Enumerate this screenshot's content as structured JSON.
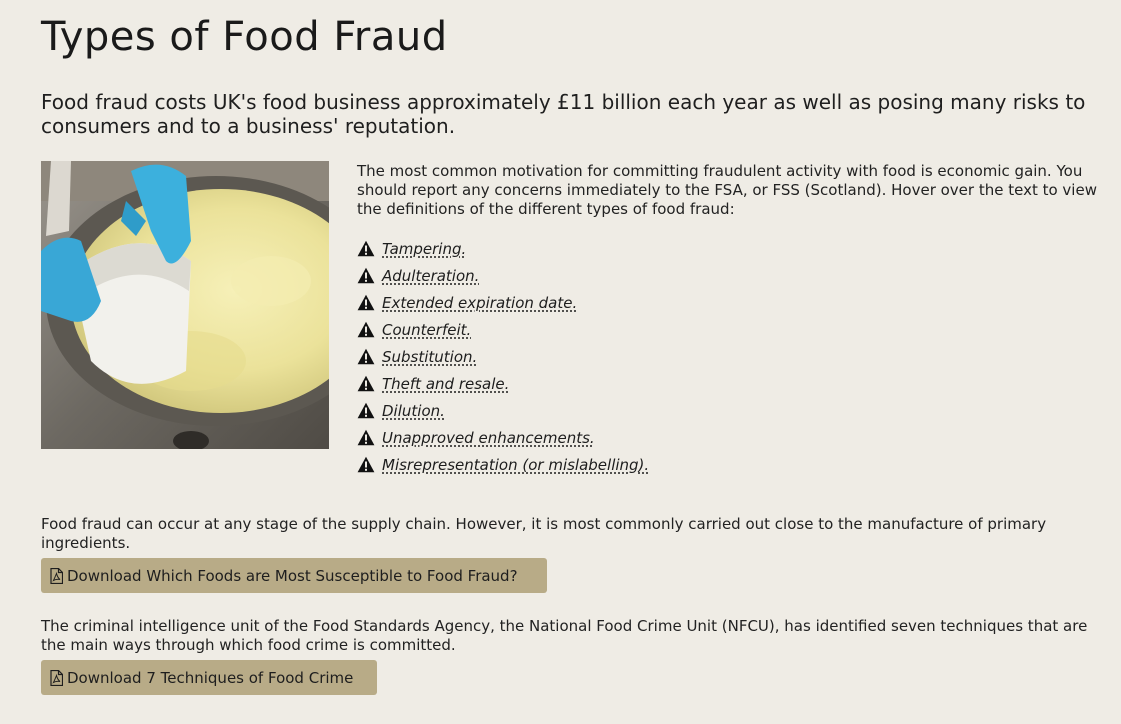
{
  "title": "Types of Food Fraud",
  "lead": "Food fraud costs UK's food business approximately £11 billion each year as well as posing many risks to consumers and to a business' reputation.",
  "hero_image": {
    "icon": "cheese-curd-vat-photo"
  },
  "intro": "The most common motivation for committing fraudulent activity with food is economic gain. You should report any concerns immediately to the FSA, or FSS (Scotland). Hover over the text to view the definitions of the different types of food fraud:",
  "fraud_types": [
    {
      "label": "Tampering."
    },
    {
      "label": "Adulteration."
    },
    {
      "label": "Extended expiration date."
    },
    {
      "label": "Counterfeit."
    },
    {
      "label": "Substitution."
    },
    {
      "label": "Theft and resale."
    },
    {
      "label": "Dilution."
    },
    {
      "label": "Unapproved enhancements."
    },
    {
      "label": "Misrepresentation (or mislabelling)."
    }
  ],
  "supply_chain_text": "Food fraud can occur at any stage of the supply chain. However, it is most commonly carried out close to the manufacture of primary ingredients.",
  "download1": {
    "label": "Download Which Foods are Most Susceptible to Food Fraud?",
    "icon": "pdf-file-icon"
  },
  "nfcu_text": "The criminal intelligence unit of the Food Standards Agency, the National Food Crime Unit (NFCU), has identified seven techniques that are the main ways through which food crime is committed.",
  "download2": {
    "label": "Download 7 Techniques of Food Crime",
    "icon": "pdf-file-icon"
  },
  "colors": {
    "background": "#efece5",
    "button": "#b8ab87",
    "text": "#222222"
  }
}
